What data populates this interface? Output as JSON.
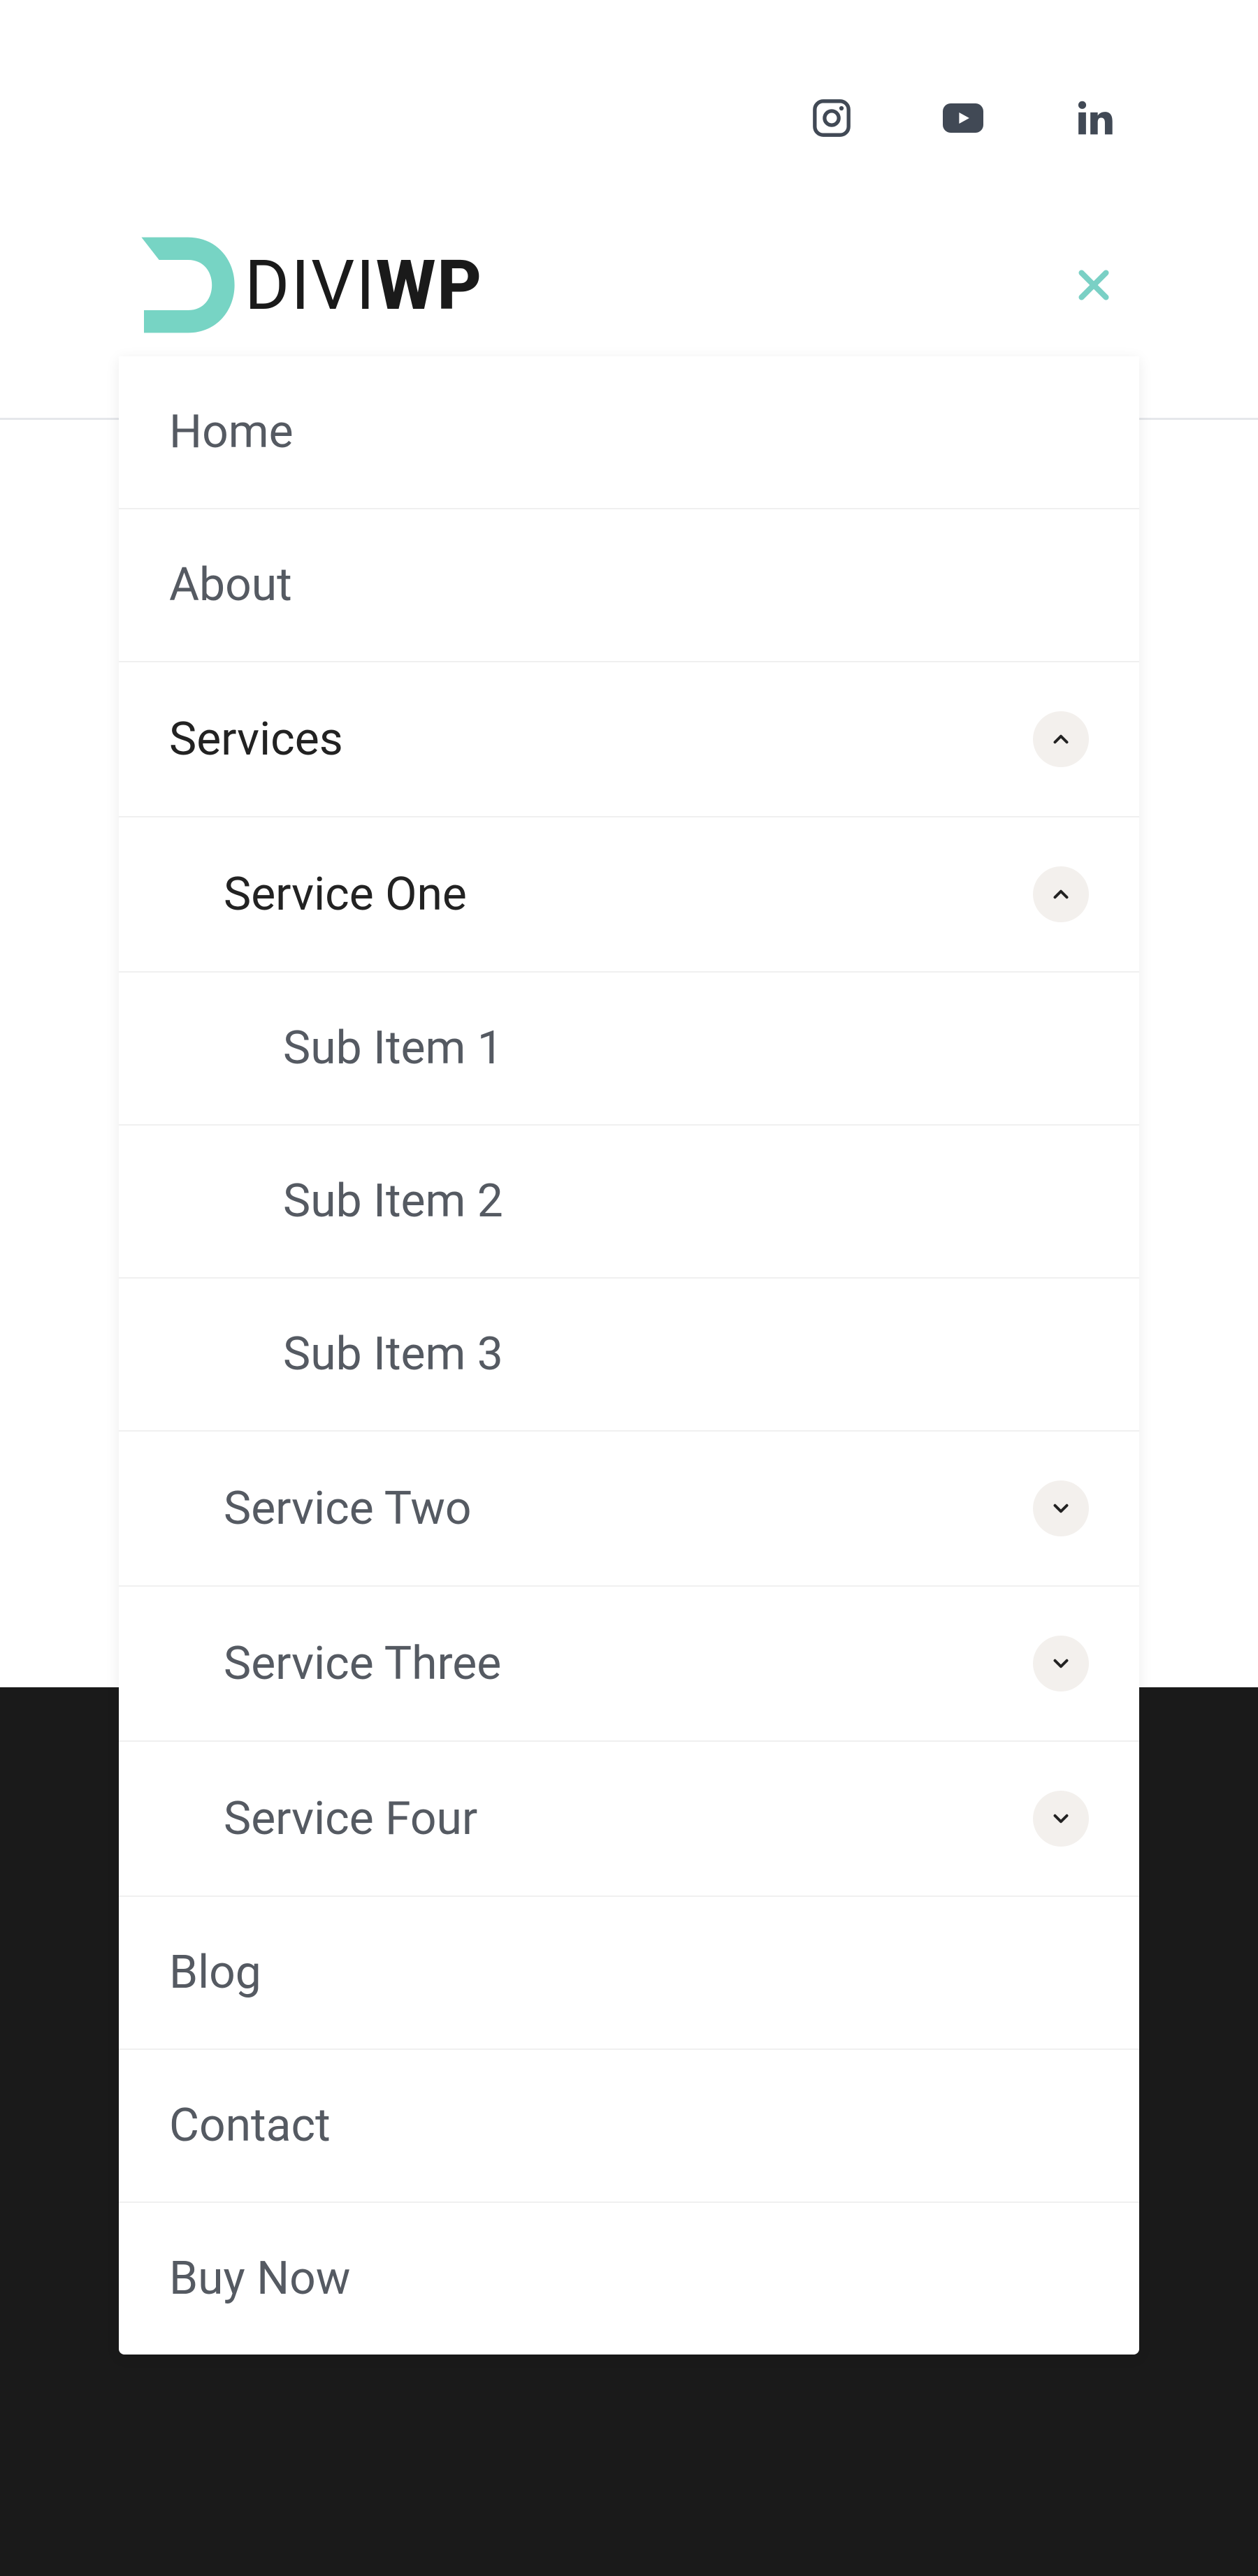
{
  "brand": {
    "name_part1": "DIVI",
    "name_part2": "WP"
  },
  "social": {
    "instagram": "instagram-icon",
    "youtube": "youtube-icon",
    "linkedin": "linkedin-icon"
  },
  "nav": {
    "items": [
      {
        "label": "Home",
        "active": false,
        "expandable": false
      },
      {
        "label": "About",
        "active": false,
        "expandable": false
      },
      {
        "label": "Services",
        "active": true,
        "expandable": true,
        "expanded": true
      },
      {
        "label": "Blog",
        "active": false,
        "expandable": false
      },
      {
        "label": "Contact",
        "active": false,
        "expandable": false
      },
      {
        "label": "Buy Now",
        "active": false,
        "expandable": false
      }
    ],
    "services": {
      "items": [
        {
          "label": "Service One",
          "active": true,
          "expandable": true,
          "expanded": true
        },
        {
          "label": "Service Two",
          "active": false,
          "expandable": true,
          "expanded": false
        },
        {
          "label": "Service Three",
          "active": false,
          "expandable": true,
          "expanded": false
        },
        {
          "label": "Service Four",
          "active": false,
          "expandable": true,
          "expanded": false
        }
      ],
      "service_one_subs": [
        {
          "label": "Sub Item 1"
        },
        {
          "label": "Sub Item 2"
        },
        {
          "label": "Sub Item 3"
        }
      ]
    }
  },
  "colors": {
    "accent": "#64c9bf",
    "dark_section": "#1a1a1a"
  }
}
